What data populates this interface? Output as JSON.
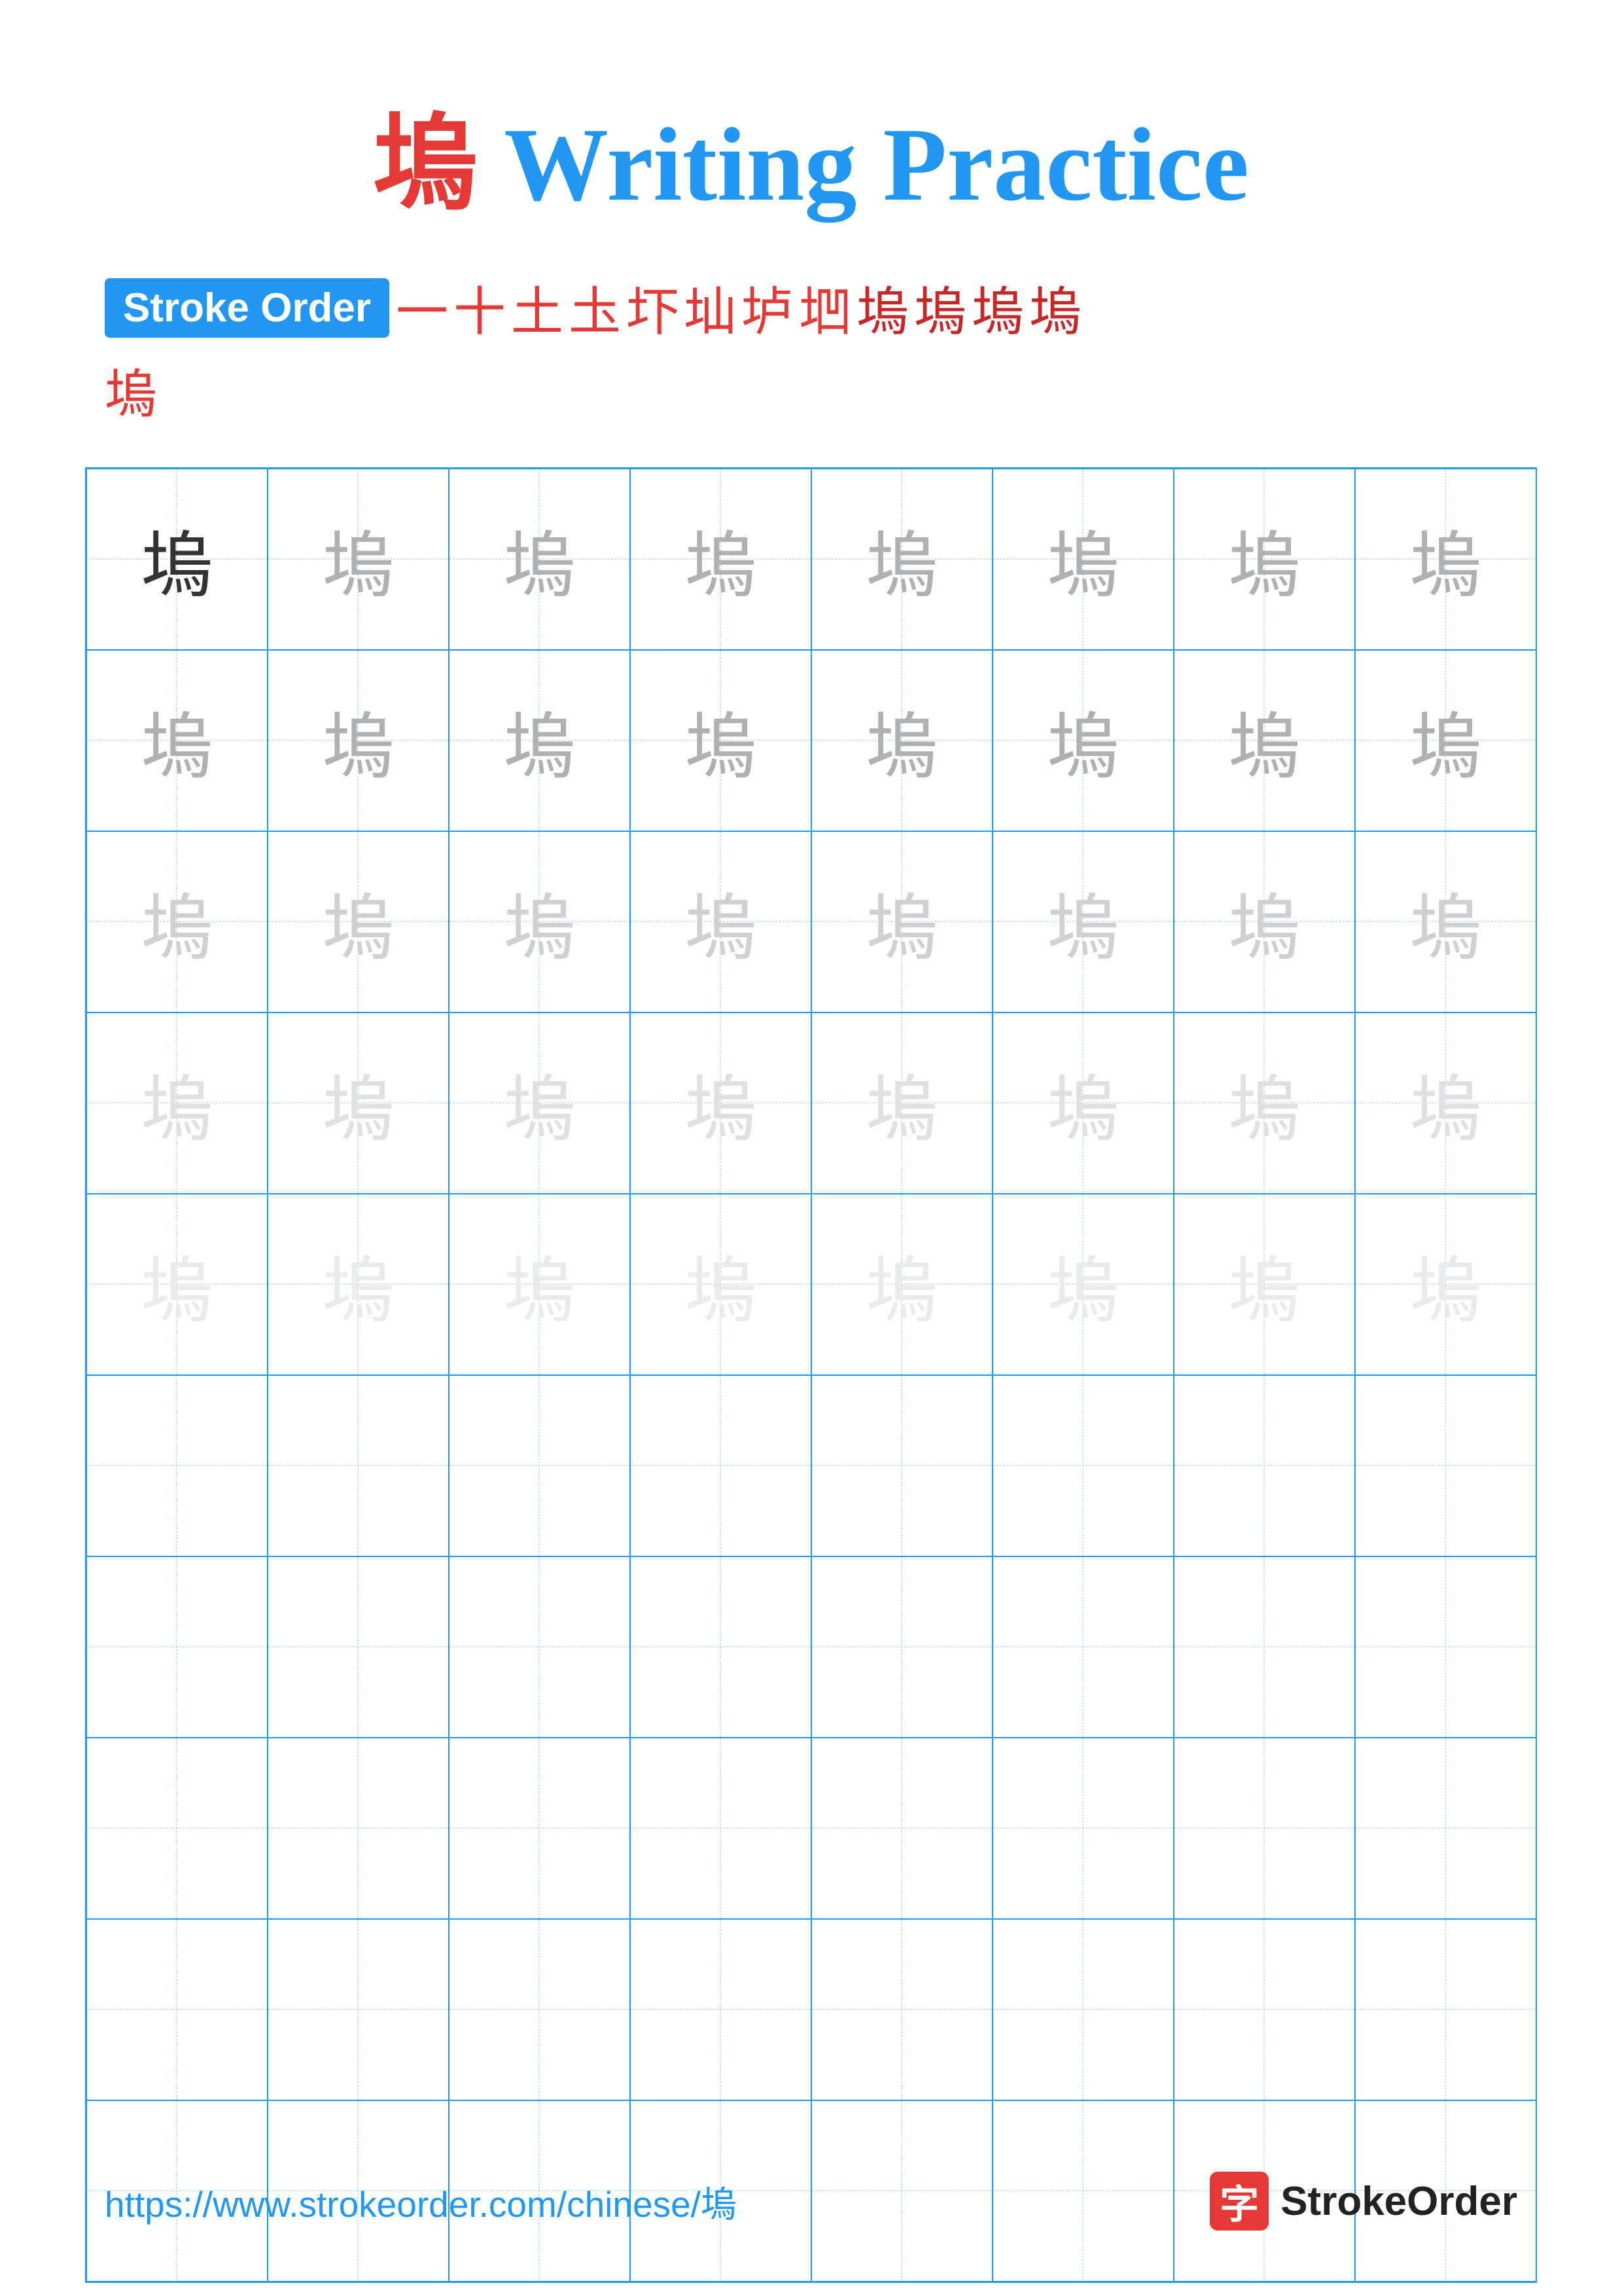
{
  "title": {
    "char": "塢",
    "text": " Writing Practice"
  },
  "stroke_order": {
    "badge": "Stroke Order",
    "chars": [
      "一",
      "十",
      "土",
      "圡",
      "圷",
      "圸",
      "垆",
      "垇",
      "塢",
      "塢",
      "塢",
      "塢"
    ],
    "last_char": "塢"
  },
  "grid": {
    "rows": 10,
    "cols": 8,
    "char": "塢",
    "opacity_rows": [
      [
        "dark",
        "medium",
        "medium",
        "medium",
        "medium",
        "medium",
        "medium",
        "medium"
      ],
      [
        "medium",
        "medium",
        "medium",
        "medium",
        "medium",
        "medium",
        "medium",
        "medium"
      ],
      [
        "light",
        "light",
        "light",
        "light",
        "light",
        "light",
        "light",
        "light"
      ],
      [
        "lighter",
        "lighter",
        "lighter",
        "lighter",
        "lighter",
        "lighter",
        "lighter",
        "lighter"
      ],
      [
        "lightest",
        "lightest",
        "lightest",
        "lightest",
        "lightest",
        "lightest",
        "lightest",
        "lightest"
      ],
      [
        "empty",
        "empty",
        "empty",
        "empty",
        "empty",
        "empty",
        "empty",
        "empty"
      ],
      [
        "empty",
        "empty",
        "empty",
        "empty",
        "empty",
        "empty",
        "empty",
        "empty"
      ],
      [
        "empty",
        "empty",
        "empty",
        "empty",
        "empty",
        "empty",
        "empty",
        "empty"
      ],
      [
        "empty",
        "empty",
        "empty",
        "empty",
        "empty",
        "empty",
        "empty",
        "empty"
      ],
      [
        "empty",
        "empty",
        "empty",
        "empty",
        "empty",
        "empty",
        "empty",
        "empty"
      ]
    ]
  },
  "footer": {
    "url": "https://www.strokeorder.com/chinese/塢",
    "logo_char": "字",
    "logo_text": "StrokeOrder"
  }
}
